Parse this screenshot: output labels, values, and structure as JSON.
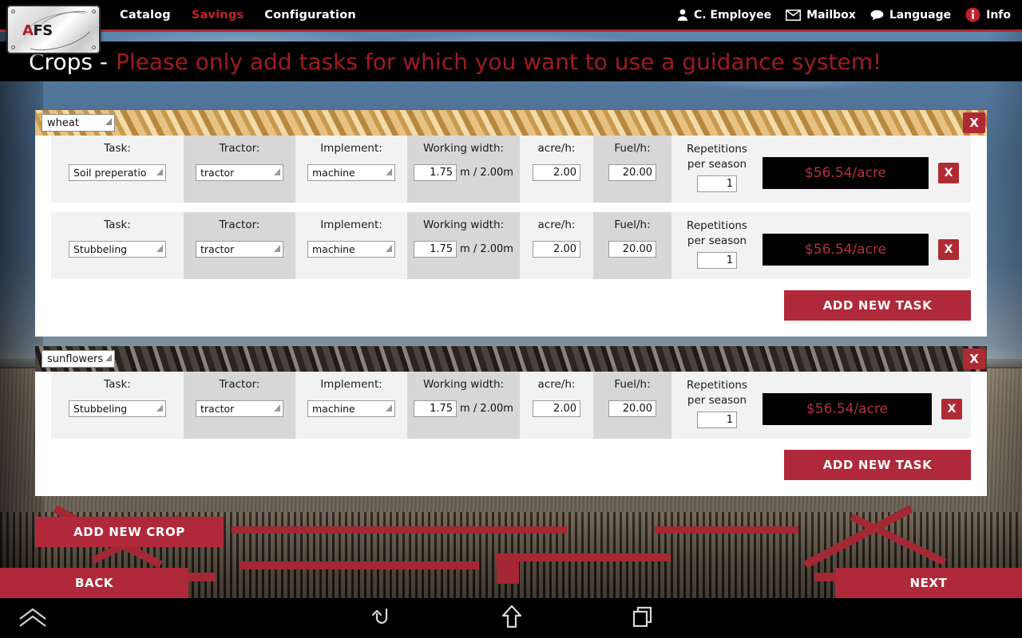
{
  "app": {
    "logo_text": "AFS",
    "logo_accent": "A"
  },
  "topnav": {
    "links": [
      {
        "label": "Catalog",
        "active": false
      },
      {
        "label": "Savings",
        "active": true
      },
      {
        "label": "Configuration",
        "active": false
      }
    ],
    "right": [
      {
        "icon": "user-icon",
        "label": "C. Employee"
      },
      {
        "icon": "mail-icon",
        "label": "Mailbox"
      },
      {
        "icon": "speech-bubble-icon",
        "label": "Language"
      },
      {
        "icon": "info-icon",
        "label": "Info"
      }
    ]
  },
  "page": {
    "title": "Crops -",
    "subtitle": "Please only add tasks for which you want to use a guidance system!"
  },
  "labels": {
    "task": "Task:",
    "tractor": "Tractor:",
    "implement": "Implement:",
    "working_width": "Working width:",
    "acre_h": "acre/h:",
    "fuel_h": "Fuel/h:",
    "repetitions_l1": "Repetitions",
    "repetitions_l2": "per season",
    "close": "X"
  },
  "buttons": {
    "add_new_task": "ADD NEW TASK",
    "add_new_crop": "ADD NEW CROP",
    "back": "BACK",
    "next": "NEXT"
  },
  "colors": {
    "brand_red": "#b0293a",
    "accent_red": "#b02a34",
    "title_red": "#9e1b22",
    "price_red": "#b3323c",
    "panel_light": "#f2f2f2",
    "panel_dark": "#d7d7d7"
  },
  "crops": [
    {
      "name": "wheat",
      "texture": "wheat",
      "tasks": [
        {
          "task": "Soil preperatio",
          "tractor": "tractor",
          "implement": "machine",
          "width_value": "1.75",
          "width_suffix": "m / 2.00m",
          "acre_h": "2.00",
          "fuel_h": "20.00",
          "repetitions": "1",
          "price": "$56.54/acre"
        },
        {
          "task": "Stubbeling",
          "tractor": "tractor",
          "implement": "machine",
          "width_value": "1.75",
          "width_suffix": "m / 2.00m",
          "acre_h": "2.00",
          "fuel_h": "20.00",
          "repetitions": "1",
          "price": "$56.54/acre"
        }
      ]
    },
    {
      "name": "sunflowers",
      "texture": "sunflower",
      "tasks": [
        {
          "task": "Stubbeling",
          "tractor": "tractor",
          "implement": "machine",
          "width_value": "1.75",
          "width_suffix": "m / 2.00m",
          "acre_h": "2.00",
          "fuel_h": "20.00",
          "repetitions": "1",
          "price": "$56.54/acre"
        }
      ]
    }
  ],
  "sysbar": {
    "items": [
      {
        "icon": "chevron-home-icon"
      },
      {
        "icon": "back-arrow-icon"
      },
      {
        "icon": "home-arrow-icon"
      },
      {
        "icon": "recent-apps-icon"
      }
    ]
  }
}
